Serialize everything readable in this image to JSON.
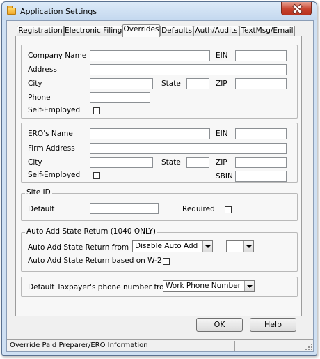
{
  "window": {
    "title": "Application Settings"
  },
  "tabs": [
    "Registration",
    "Electronic Filing",
    "Overrides",
    "Defaults",
    "Auth/Audits",
    "TextMsg/Email"
  ],
  "active_tab": "Overrides",
  "preparer": {
    "company_name_label": "Company Name",
    "ein_label": "EIN",
    "address_label": "Address",
    "city_label": "City",
    "state_label": "State",
    "zip_label": "ZIP",
    "phone_label": "Phone",
    "self_employed_label": "Self-Employed"
  },
  "ero": {
    "ero_name_label": "ERO's Name",
    "ein_label": "EIN",
    "firm_address_label": "Firm Address",
    "city_label": "City",
    "state_label": "State",
    "zip_label": "ZIP",
    "self_employed_label": "Self-Employed",
    "sbin_label": "SBIN"
  },
  "site_id": {
    "legend": "Site ID",
    "default_label": "Default",
    "required_label": "Required"
  },
  "auto_add": {
    "legend": "Auto Add State Return (1040 ONLY)",
    "from_label": "Auto Add State Return from",
    "from_value": "Disable Auto Add",
    "second_value": "",
    "w2_label": "Auto Add State Return based on W-2"
  },
  "phone_default": {
    "label": "Default Taxpayer's phone number from",
    "value": "Work Phone Number"
  },
  "buttons": {
    "ok": "OK",
    "help": "Help"
  },
  "status": {
    "text": "Override Paid Preparer/ERO Information"
  }
}
